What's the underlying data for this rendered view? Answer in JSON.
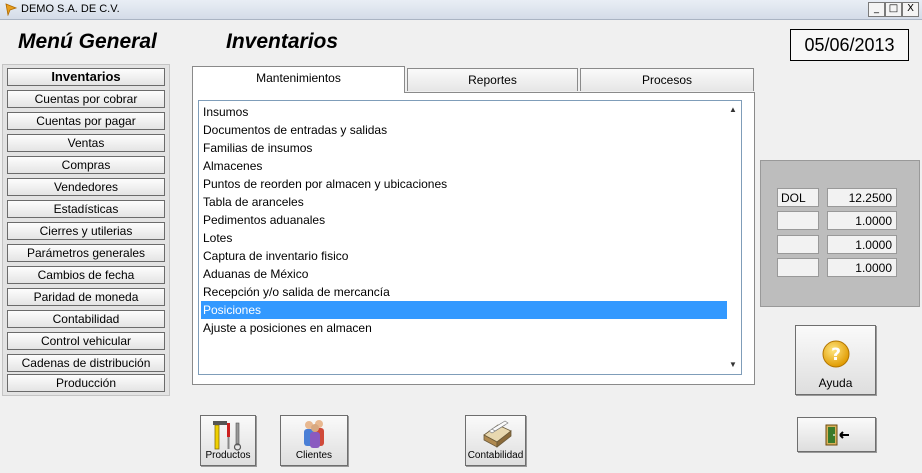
{
  "window": {
    "title": "DEMO  S.A. DE C.V.",
    "minimize": "_",
    "maximize": "□",
    "close": "X"
  },
  "header": {
    "menu_title": "Menú General",
    "section_title": "Inventarios",
    "date": "05/06/2013"
  },
  "sidebar": {
    "items": [
      {
        "label": "Inventarios"
      },
      {
        "label": "Cuentas por cobrar"
      },
      {
        "label": "Cuentas por pagar"
      },
      {
        "label": "Ventas"
      },
      {
        "label": "Compras"
      },
      {
        "label": "Vendedores"
      },
      {
        "label": "Estadísticas"
      },
      {
        "label": "Cierres y utilerias"
      },
      {
        "label": "Parámetros generales"
      },
      {
        "label": "Cambios de fecha"
      },
      {
        "label": "Paridad de moneda"
      },
      {
        "label": "Contabilidad"
      },
      {
        "label": "Control vehicular"
      },
      {
        "label": "Cadenas de distribución"
      },
      {
        "label": "Producción"
      }
    ]
  },
  "tabs": [
    {
      "label": "Mantenimientos"
    },
    {
      "label": "Reportes"
    },
    {
      "label": "Procesos"
    }
  ],
  "list": {
    "items": [
      "Insumos",
      "Documentos de entradas y salidas",
      "Familias de insumos",
      "Almacenes",
      "Puntos de reorden por almacen y ubicaciones",
      "Tabla de aranceles",
      "Pedimentos aduanales",
      "Lotes",
      "Captura de inventario fisico",
      "Aduanas de México",
      "Recepción y/o salida de mercancía",
      "Posiciones",
      "Ajuste a  posiciones en almacen"
    ],
    "selected_index": 11
  },
  "currencies": [
    {
      "code": "DOL",
      "value": "12.2500"
    },
    {
      "code": "",
      "value": "1.0000"
    },
    {
      "code": "",
      "value": "1.0000"
    },
    {
      "code": "",
      "value": "1.0000"
    }
  ],
  "buttons": {
    "help": "Ayuda",
    "products": "Productos",
    "clients": "Clientes",
    "accounting": "Contabilidad"
  },
  "colors": {
    "selection": "#3399ff",
    "help_icon": "#f5b800"
  }
}
